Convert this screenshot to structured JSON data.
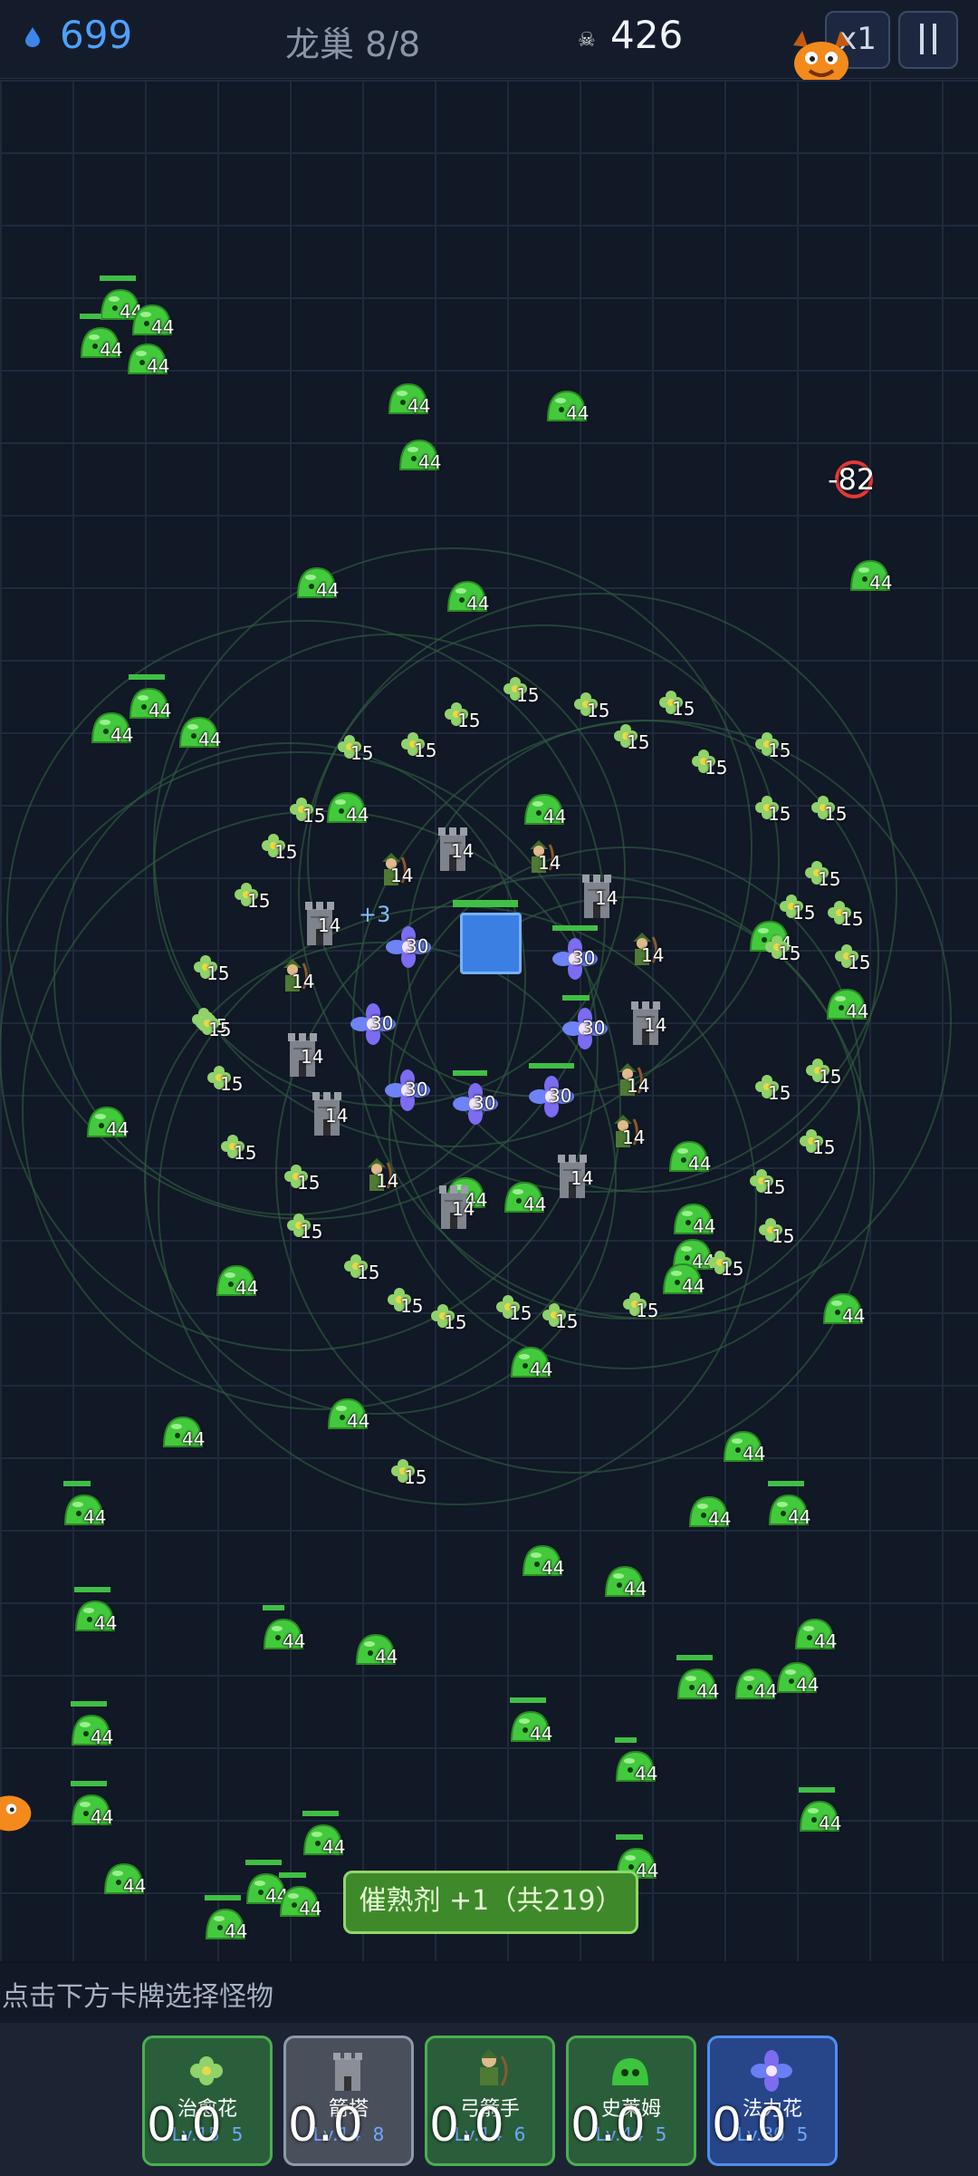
{
  "top_bar": {
    "resource": "699",
    "level_label": "龙巢 8/8",
    "kills": "426",
    "speed_label": "x1",
    "pause_icon": "pause-icon"
  },
  "floating": {
    "damage": "-82",
    "heal": "+3"
  },
  "toast": "催熟剂 +1（共219）",
  "hint": "点击下方卡牌选择怪物",
  "cards": [
    {
      "name": "治愈花",
      "level": "Lv.15",
      "count": "5",
      "cooldown": "0.0",
      "icon": "green-flower-icon"
    },
    {
      "name": "箭塔",
      "level": "Lv.14",
      "count": "8",
      "cooldown": "0.0",
      "icon": "stone-tower-icon"
    },
    {
      "name": "弓箭手",
      "level": "Lv.14",
      "count": "6",
      "cooldown": "0.0",
      "icon": "archer-icon"
    },
    {
      "name": "史莱姆",
      "level": "Lv.44",
      "count": "5",
      "cooldown": "0.0",
      "icon": "slime-icon"
    },
    {
      "name": "法力花",
      "level": "Lv.30",
      "count": "5",
      "cooldown": "0.0",
      "icon": "mana-flower-icon"
    }
  ],
  "colors": {
    "background": "#111826",
    "accent_blue": "#4ea1ff",
    "slime_green": "#3fbf45",
    "toast_green": "#3e8a2a"
  },
  "units": {
    "slime_level": "44",
    "heal_flower_level": "15",
    "tower_level": "14",
    "archer_level": "14",
    "mana_flower_level": "30"
  }
}
